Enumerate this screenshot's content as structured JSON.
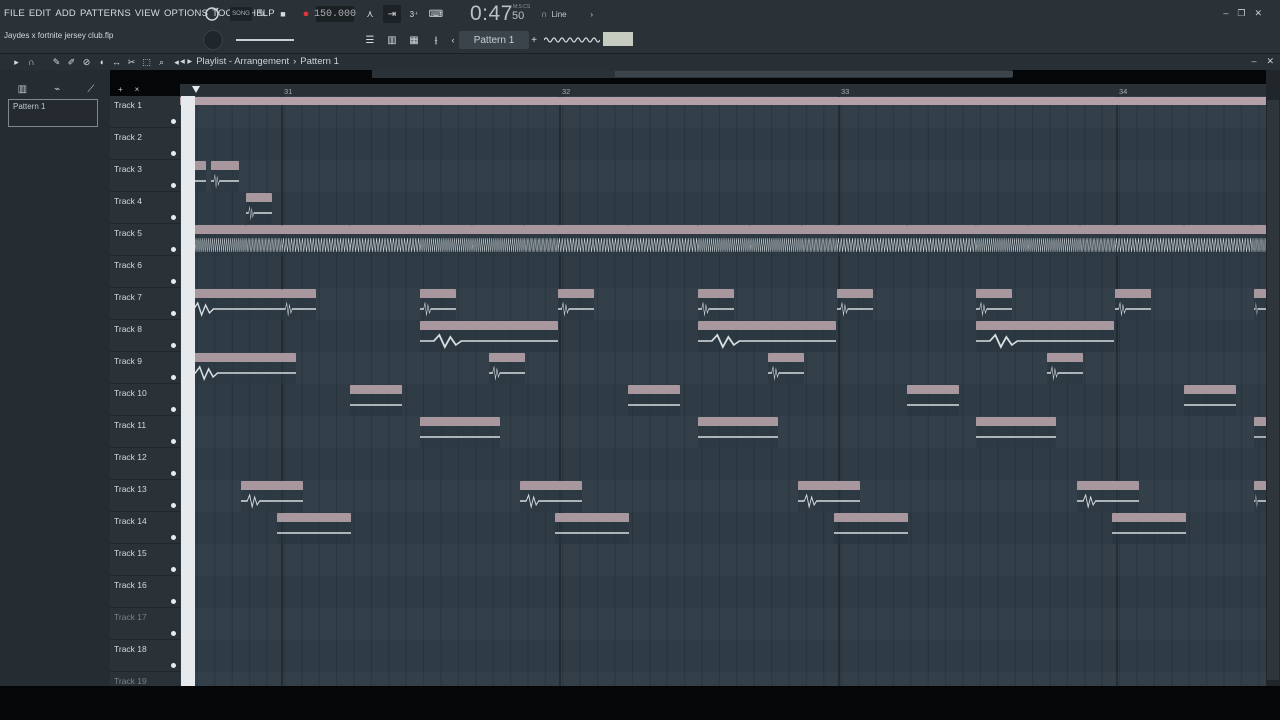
{
  "menu": [
    "FILE",
    "EDIT",
    "ADD",
    "PATTERNS",
    "VIEW",
    "OPTIONS",
    "TOOLS",
    "HELP"
  ],
  "project_file": "Jaydes x fortnite jersey club.flp",
  "transport": {
    "mode": "SONG",
    "tempo": "150.000",
    "time_main": "0:47",
    "time_cs": "50",
    "time_unit": "M:S:CS",
    "snap": "Line"
  },
  "pattern_selector": "Pattern 1",
  "playlist": {
    "title": "Playlist - Arrangement",
    "separator": "›",
    "pattern": "Pattern 1",
    "picker_items": [
      "Pattern 1"
    ],
    "ruler_marks": [
      {
        "label": "31"
      },
      {
        "label": "32"
      },
      {
        "label": "33"
      },
      {
        "label": "34"
      }
    ],
    "tracks": [
      {
        "name": "Track 1",
        "dim": false
      },
      {
        "name": "Track 2",
        "dim": false
      },
      {
        "name": "Track 3",
        "dim": false
      },
      {
        "name": "Track 4",
        "dim": false
      },
      {
        "name": "Track 5",
        "dim": false
      },
      {
        "name": "Track 6",
        "dim": false
      },
      {
        "name": "Track 7",
        "dim": false
      },
      {
        "name": "Track 8",
        "dim": false
      },
      {
        "name": "Track 9",
        "dim": false
      },
      {
        "name": "Track 10",
        "dim": false
      },
      {
        "name": "Track 11",
        "dim": false
      },
      {
        "name": "Track 12",
        "dim": false
      },
      {
        "name": "Track 13",
        "dim": false
      },
      {
        "name": "Track 14",
        "dim": false
      },
      {
        "name": "Track 15",
        "dim": false
      },
      {
        "name": "Track 16",
        "dim": false
      },
      {
        "name": "Track 17",
        "dim": true
      },
      {
        "name": "Track 18",
        "dim": false
      },
      {
        "name": "Track 19",
        "dim": true
      }
    ]
  },
  "colors": {
    "clip_header": "#a9979f",
    "grid_bg": "#33404a",
    "track_col_bg": "#2b3237",
    "toolbar_bg": "#2a3137"
  }
}
